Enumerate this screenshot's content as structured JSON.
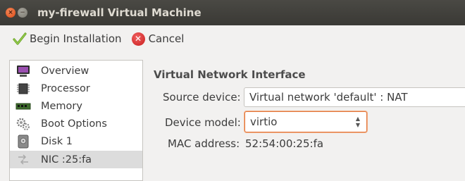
{
  "window": {
    "title": "my-firewall Virtual Machine",
    "close_glyph": "×",
    "minimize_glyph": "−"
  },
  "toolbar": {
    "begin_label": "Begin Installation",
    "cancel_label": "Cancel",
    "cancel_glyph": "✕"
  },
  "sidebar": {
    "items": [
      {
        "label": "Overview",
        "icon": "monitor-icon"
      },
      {
        "label": "Processor",
        "icon": "chip-icon"
      },
      {
        "label": "Memory",
        "icon": "memory-icon"
      },
      {
        "label": "Boot Options",
        "icon": "gears-icon"
      },
      {
        "label": "Disk 1",
        "icon": "disk-icon"
      },
      {
        "label": "NIC :25:fa",
        "icon": "network-icon",
        "selected": true
      }
    ]
  },
  "main": {
    "section_title": "Virtual Network Interface",
    "source_device_label": "Source device:",
    "source_device_value": "Virtual network 'default' : NAT",
    "device_model_label": "Device model:",
    "device_model_value": "virtio",
    "mac_label": "MAC address:",
    "mac_value": "52:54:00:25:fa"
  },
  "colors": {
    "titlebar": "#3c3b37",
    "close_button": "#dd4814",
    "focus_ring": "#e2773c",
    "selection": "#dcdcdc"
  }
}
